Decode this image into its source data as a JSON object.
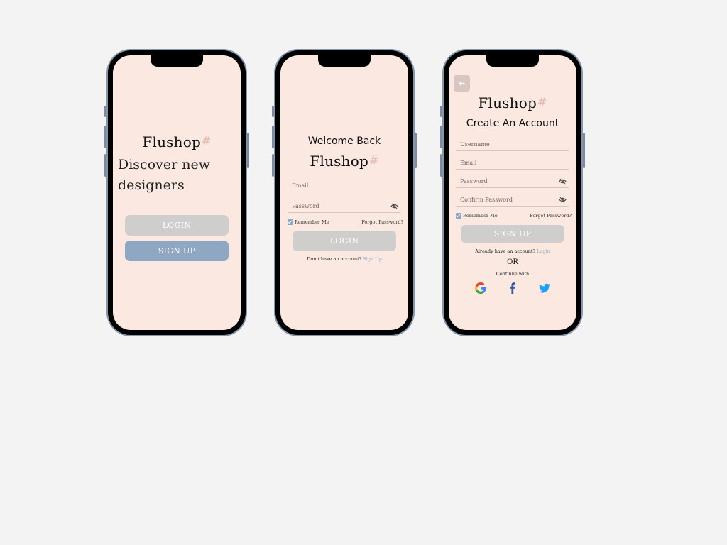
{
  "brand": {
    "name": "Flushop",
    "mark": "#"
  },
  "screen1": {
    "tagline": "Discover new designers",
    "login_label": "LOGIN",
    "signup_label": "SIGN UP"
  },
  "screen2": {
    "heading": "Welcome Back",
    "email_label": "Email",
    "password_label": "Password",
    "remember_label": "Remember Me",
    "forgot_label": "Forgot Password?",
    "login_label": "LOGIN",
    "no_account_text": "Don't have an account?",
    "signup_link": "Sign Up"
  },
  "screen3": {
    "heading": "Create An Account",
    "username_label": "Username",
    "email_label": "Email",
    "password_label": "Password",
    "confirm_label": "Confirm Password",
    "remember_label": "Remember Me",
    "forgot_label": "Forgot Password?",
    "signup_label": "SIGN UP",
    "have_account_text": "Already have an account?",
    "login_link": "Login",
    "or_text": "OR",
    "continue_text": "Continue with",
    "social_icons": [
      "google-icon",
      "facebook-icon",
      "twitter-icon"
    ]
  },
  "colors": {
    "background": "#f3f3f3",
    "screen": "#fbe8e1",
    "primary_blue": "#8ea8c3",
    "disabled_grey": "#cfcecd",
    "brand_mark": "#e6b8b0"
  }
}
